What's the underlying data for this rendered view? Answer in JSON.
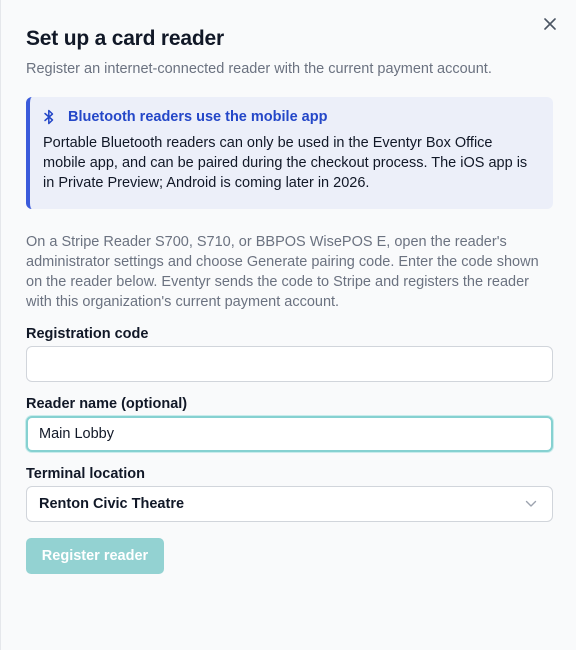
{
  "dialog": {
    "title": "Set up a card reader",
    "subtitle": "Register an internet-connected reader with the current payment account."
  },
  "notice": {
    "icon": "bluetooth-icon",
    "title": "Bluetooth readers use the mobile app",
    "body": "Portable Bluetooth readers can only be used in the Eventyr Box Office mobile app, and can be paired during the checkout process. The iOS app is in Private Preview; Android is coming later in 2026."
  },
  "instructions": "On a Stripe Reader S700, S710, or BBPOS WisePOS E, open the reader's administrator settings and choose Generate pairing code. Enter the code shown on the reader below. Eventyr sends the code to Stripe and registers the reader with this organization's current payment account.",
  "form": {
    "registration_code": {
      "label": "Registration code",
      "value": ""
    },
    "reader_name": {
      "label": "Reader name (optional)",
      "value": "Main Lobby"
    },
    "terminal_location": {
      "label": "Terminal location",
      "selected": "Renton Civic Theatre"
    },
    "submit_label": "Register reader"
  },
  "colors": {
    "accent": "#93d2d2",
    "notice_border": "#3b5bdb",
    "notice_title": "#2447c8"
  }
}
